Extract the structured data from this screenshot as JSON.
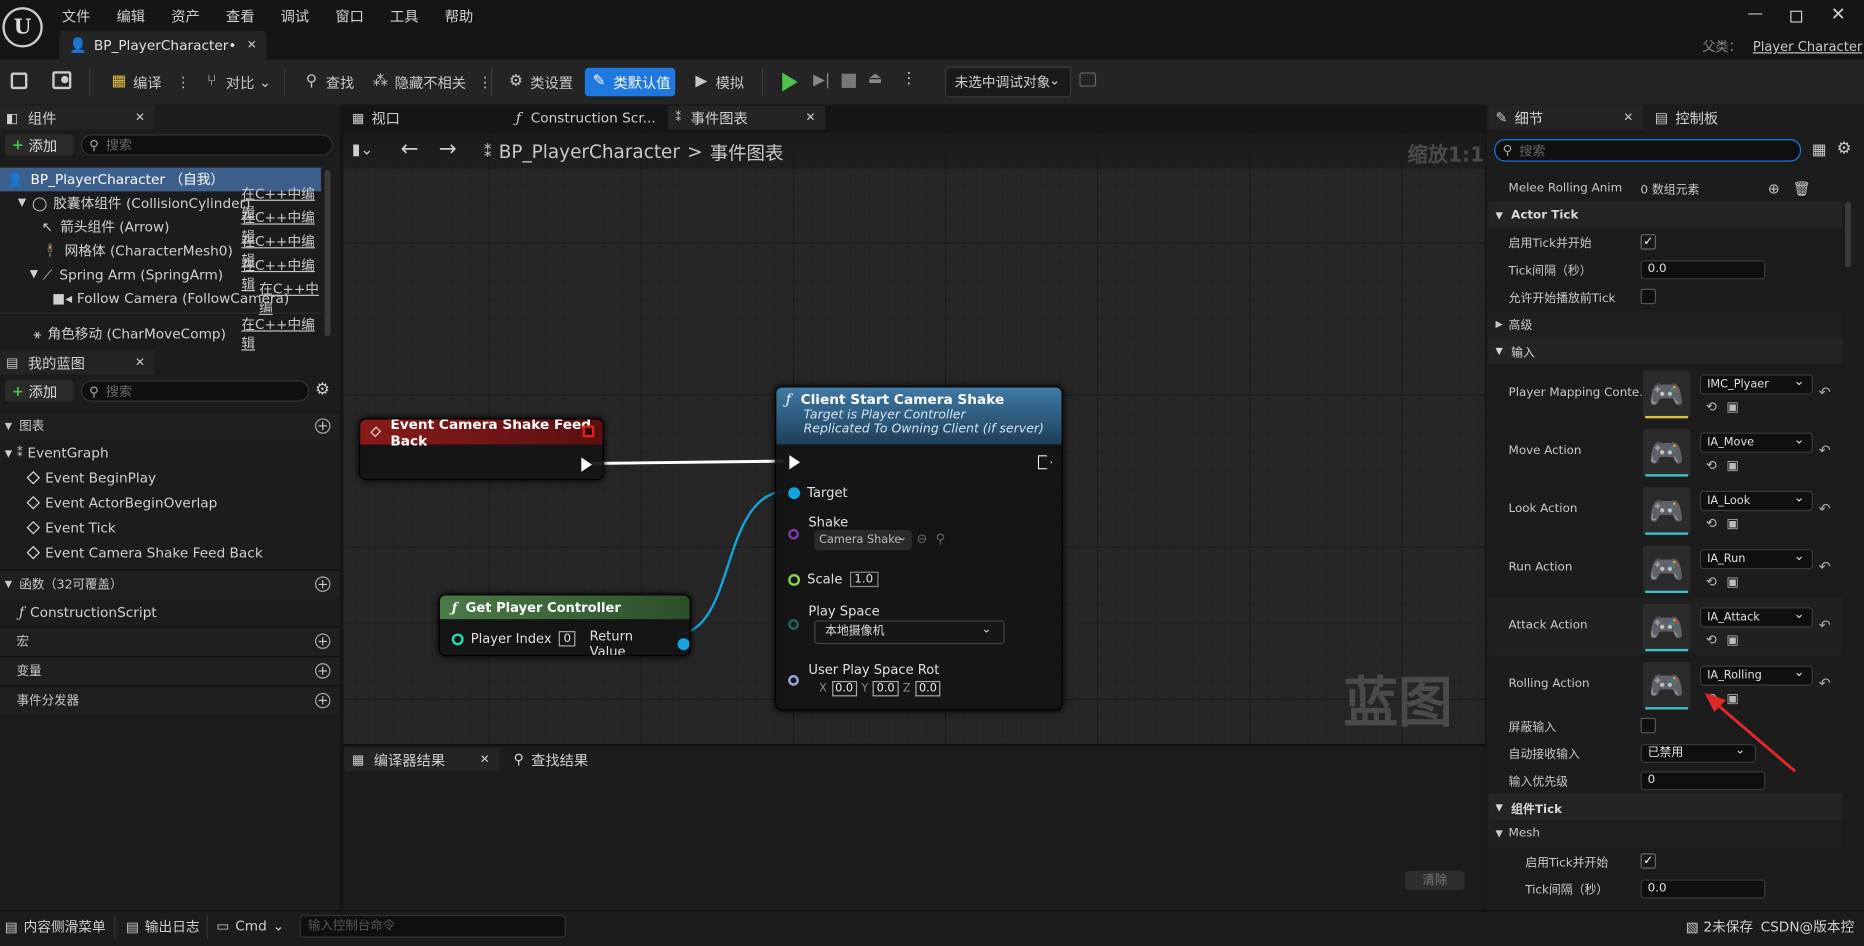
{
  "menu": [
    "文件",
    "编辑",
    "资产",
    "查看",
    "调试",
    "窗口",
    "工具",
    "帮助"
  ],
  "tab": {
    "title": "BP_PlayerCharacter•"
  },
  "parent": {
    "label": "父类：",
    "value": "Player Character"
  },
  "toolbar": {
    "compile": "编译",
    "diff": "对比",
    "find": "查找",
    "hide_unrelated": "隐藏不相关",
    "class_settings": "类设置",
    "class_defaults": "类默认值",
    "simulate": "模拟",
    "debug_target": "未选中调试对象"
  },
  "components": {
    "title": "组件",
    "add": "添加",
    "search_placeholder": "搜索",
    "items": [
      {
        "label": "BP_PlayerCharacter （自我）",
        "edit": ""
      },
      {
        "label": "胶囊体组件 (CollisionCylinder)",
        "edit": "在C++中编辑"
      },
      {
        "label": "箭头组件 (Arrow)",
        "edit": "在C++中编辑"
      },
      {
        "label": "网格体 (CharacterMesh0)",
        "edit": "在C++中编辑"
      },
      {
        "label": "Spring Arm (SpringArm)",
        "edit": "在C++中编辑"
      },
      {
        "label": "Follow Camera (FollowCamera)",
        "edit": "在C++中编"
      },
      {
        "label": "角色移动 (CharMoveComp)",
        "edit": "在C++中编辑"
      }
    ]
  },
  "my_blueprint": {
    "title": "我的蓝图",
    "add": "添加",
    "search_placeholder": "搜索",
    "graphs_label": "图表",
    "event_graph": "EventGraph",
    "events": [
      "Event BeginPlay",
      "Event ActorBeginOverlap",
      "Event Tick",
      "Event Camera Shake Feed Back"
    ],
    "functions_label": "函数（32可覆盖）",
    "construction": "ConstructionScript",
    "macros": "宏",
    "variables": "变量",
    "dispatchers": "事件分发器"
  },
  "editor_tabs": [
    "视口",
    "Construction Scr...",
    "事件图表"
  ],
  "breadcrumb": {
    "bp": "BP_PlayerCharacter",
    "sep": ">",
    "graph": "事件图表",
    "zoom": "缩放1:1"
  },
  "watermark": "蓝图",
  "nodes": {
    "event": {
      "title": "Event Camera Shake Feed Back"
    },
    "client": {
      "title": "Client Start Camera Shake",
      "sub1": "Target is Player Controller",
      "sub2": "Replicated To Owning Client (if server)",
      "target": "Target",
      "shake": "Shake",
      "shake_val": "Camera Shake",
      "scale": "Scale",
      "scale_val": "1.0",
      "play_space": "Play Space",
      "play_space_val": "本地摄像机",
      "rot": "User Play Space Rot",
      "x": "0.0",
      "y": "0.0",
      "z": "0.0"
    },
    "get_pc": {
      "title": "Get Player Controller",
      "index": "Player Index",
      "index_val": "0",
      "ret": "Return Value"
    }
  },
  "bottom_tabs": {
    "compiler": "编译器结果",
    "find": "查找结果",
    "clear": "清除"
  },
  "details": {
    "tab": "细节",
    "tab2": "控制板",
    "search_placeholder": "搜索",
    "melee": {
      "label": "Melee Rolling Anim",
      "value": "0 数组元素"
    },
    "actor_tick": "Actor Tick",
    "tick_start": "启用Tick并开始",
    "tick_interval": "Tick间隔（秒）",
    "tick_interval_val": "0.0",
    "allow_tick": "允许开始播放前Tick",
    "advanced": "高级",
    "input": "输入",
    "mapping": {
      "label": "Player Mapping Conte...",
      "value": "IMC_Plyaer"
    },
    "actions": [
      {
        "label": "Move Action",
        "value": "IA_Move"
      },
      {
        "label": "Look Action",
        "value": "IA_Look"
      },
      {
        "label": "Run Action",
        "value": "IA_Run"
      },
      {
        "label": "Attack Action",
        "value": "IA_Attack"
      },
      {
        "label": "Rolling Action",
        "value": "IA_Rolling"
      }
    ],
    "block_input": "屏蔽输入",
    "auto_receive": "自动接收输入",
    "auto_receive_val": "已禁用",
    "input_priority": "输入优先级",
    "input_priority_val": "0",
    "component_tick": "组件Tick",
    "mesh": "Mesh",
    "mesh_tick_start": "启用Tick并开始",
    "mesh_tick_interval": "Tick间隔（秒）",
    "mesh_tick_interval_val": "0.0"
  },
  "status": {
    "drawer": "内容侧滑菜单",
    "log": "输出日志",
    "cmd": "Cmd",
    "cmd_placeholder": "输入控制台命令",
    "unsaved": "2未保存",
    "source": "CSDN@版本控"
  }
}
